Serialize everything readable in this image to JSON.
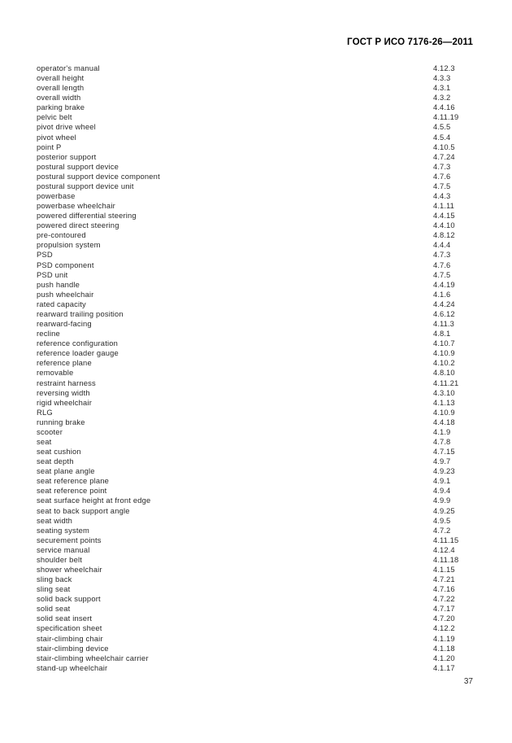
{
  "header": {
    "standard_title": "ГОСТ Р ИСО 7176-26—2011"
  },
  "footer": {
    "page_number": "37"
  },
  "index": {
    "entries": [
      {
        "term": "operator's manual",
        "ref": "4.12.3"
      },
      {
        "term": "overall height",
        "ref": "4.3.3"
      },
      {
        "term": "overall length",
        "ref": "4.3.1"
      },
      {
        "term": "overall width",
        "ref": "4.3.2"
      },
      {
        "term": "parking brake",
        "ref": "4.4.16"
      },
      {
        "term": "pelvic belt",
        "ref": "4.11.19"
      },
      {
        "term": "pivot drive wheel",
        "ref": "4.5.5"
      },
      {
        "term": "pivot wheel",
        "ref": "4.5.4"
      },
      {
        "term": "point P",
        "ref": "4.10.5"
      },
      {
        "term": "posterior support",
        "ref": "4.7.24"
      },
      {
        "term": "postural support device",
        "ref": "4.7.3"
      },
      {
        "term": "postural support device component",
        "ref": "4.7.6"
      },
      {
        "term": "postural support device unit",
        "ref": "4.7.5"
      },
      {
        "term": "powerbase",
        "ref": "4.4.3"
      },
      {
        "term": "powerbase wheelchair",
        "ref": "4.1.11"
      },
      {
        "term": "powered differential steering",
        "ref": "4.4.15"
      },
      {
        "term": "powered direct steering",
        "ref": "4.4.10"
      },
      {
        "term": "pre-contoured",
        "ref": "4.8.12"
      },
      {
        "term": "propulsion system",
        "ref": "4.4.4"
      },
      {
        "term": "PSD",
        "ref": "4.7.3"
      },
      {
        "term": "PSD component",
        "ref": "4.7.6"
      },
      {
        "term": "PSD unit",
        "ref": "4.7.5"
      },
      {
        "term": "push handle",
        "ref": "4.4.19"
      },
      {
        "term": "push wheelchair",
        "ref": "4.1.6"
      },
      {
        "term": "rated capacity",
        "ref": "4.4.24"
      },
      {
        "term": "rearward trailing position",
        "ref": "4.6.12"
      },
      {
        "term": "rearward-facing",
        "ref": "4.11.3"
      },
      {
        "term": "recline",
        "ref": "4.8.1"
      },
      {
        "term": "reference configuration",
        "ref": "4.10.7"
      },
      {
        "term": "reference loader gauge",
        "ref": "4.10.9"
      },
      {
        "term": "reference plane",
        "ref": "4.10.2"
      },
      {
        "term": "removable",
        "ref": "4.8.10"
      },
      {
        "term": "restraint harness",
        "ref": "4.11.21"
      },
      {
        "term": "reversing width",
        "ref": "4.3.10"
      },
      {
        "term": "rigid wheelchair",
        "ref": "4.1.13"
      },
      {
        "term": "RLG",
        "ref": "4.10.9"
      },
      {
        "term": "running brake",
        "ref": "4.4.18"
      },
      {
        "term": "scooter",
        "ref": "4.1.9"
      },
      {
        "term": "seat",
        "ref": "4.7.8"
      },
      {
        "term": "seat cushion",
        "ref": "4.7.15"
      },
      {
        "term": "seat depth",
        "ref": "4.9.7"
      },
      {
        "term": "seat plane angle",
        "ref": "4.9.23"
      },
      {
        "term": "seat reference plane",
        "ref": "4.9.1"
      },
      {
        "term": "seat reference point",
        "ref": "4.9.4"
      },
      {
        "term": "seat surface height at front edge",
        "ref": "4.9.9"
      },
      {
        "term": "seat to back support angle",
        "ref": "4.9.25"
      },
      {
        "term": "seat width",
        "ref": "4.9.5"
      },
      {
        "term": "seating system",
        "ref": "4.7.2"
      },
      {
        "term": "securement points",
        "ref": "4.11.15"
      },
      {
        "term": "service manual",
        "ref": "4.12.4"
      },
      {
        "term": "shoulder belt",
        "ref": "4.11.18"
      },
      {
        "term": "shower wheelchair",
        "ref": "4.1.15"
      },
      {
        "term": "sling back",
        "ref": "4.7.21"
      },
      {
        "term": "sling seat",
        "ref": "4.7.16"
      },
      {
        "term": "solid back support",
        "ref": "4.7.22"
      },
      {
        "term": "solid seat",
        "ref": "4.7.17"
      },
      {
        "term": "solid seat insert",
        "ref": "4.7.20"
      },
      {
        "term": "specification sheet",
        "ref": "4.12.2"
      },
      {
        "term": "stair-climbing chair",
        "ref": "4.1.19"
      },
      {
        "term": "stair-climbing device",
        "ref": "4.1.18"
      },
      {
        "term": "stair-climbing wheelchair carrier",
        "ref": "4.1.20"
      },
      {
        "term": "stand-up wheelchair",
        "ref": "4.1.17"
      }
    ]
  }
}
